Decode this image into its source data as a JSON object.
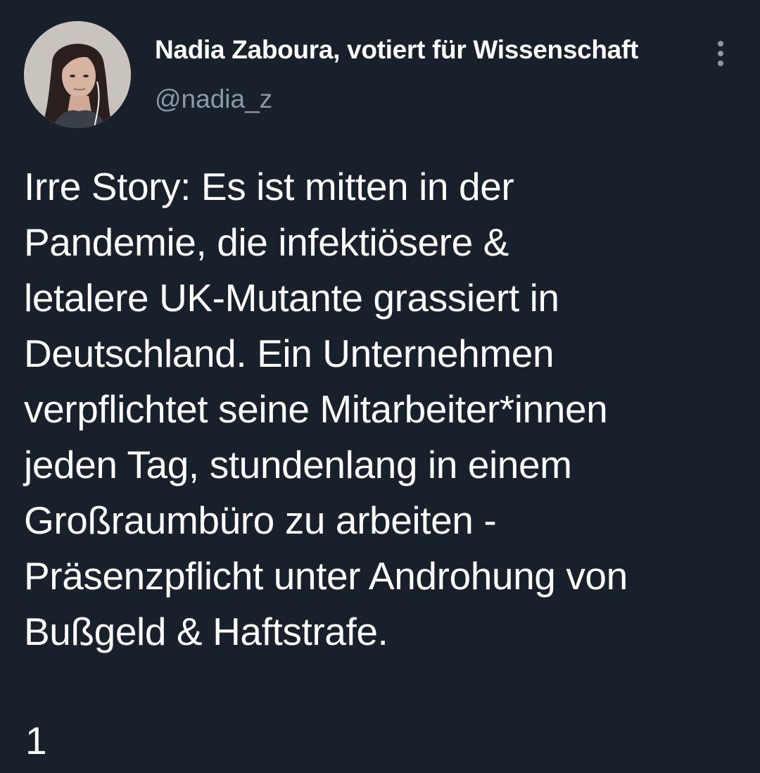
{
  "author": {
    "display_name": "Nadia Zaboura, votiert für Wissenschaft",
    "handle": "@nadia_z"
  },
  "tweet": {
    "lines": [
      "Irre Story: Es ist mitten in der",
      "Pandemie, die infektiösere &",
      "letalere UK-Mutante grassiert in",
      "Deutschland. Ein Unternehmen",
      "verpflichtet seine Mitarbeiter*innen",
      "jeden Tag, stundenlang in einem",
      "Großraumbüro zu arbeiten -",
      "Präsenzpflicht unter Androhung von",
      "Bußgeld & Haftstrafe."
    ],
    "thread_number": "1"
  },
  "icons": {
    "more": "more-vertical-icon"
  },
  "colors": {
    "background": "#17202b",
    "text": "#ffffff",
    "secondary_text": "#8b98a5"
  }
}
